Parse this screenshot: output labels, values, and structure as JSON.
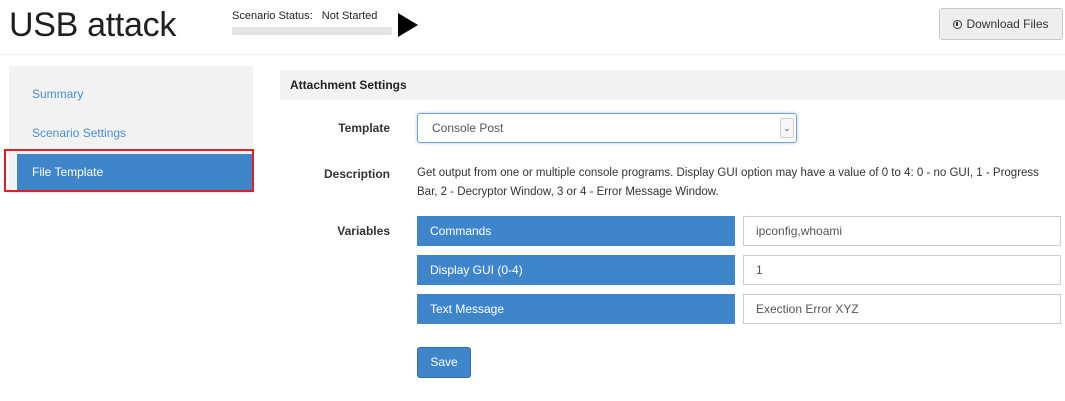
{
  "page": {
    "title": "USB attack"
  },
  "status": {
    "label": "Scenario Status:",
    "value": "Not Started"
  },
  "header": {
    "download_label": "Download Files",
    "download_icon": "download-circle-icon"
  },
  "sidebar": {
    "items": [
      {
        "label": "Summary",
        "active": false
      },
      {
        "label": "Scenario Settings",
        "active": false
      },
      {
        "label": "File Template",
        "active": true
      }
    ]
  },
  "panel": {
    "title": "Attachment Settings"
  },
  "form": {
    "template_label": "Template",
    "template_value": "Console Post",
    "description_label": "Description",
    "description_text": "Get output from one or multiple console programs. Display GUI option may have a value of 0 to 4: 0 - no GUI, 1 - Progress Bar, 2 - Decryptor Window, 3 or 4 - Error Message Window.",
    "variables_label": "Variables",
    "variables": [
      {
        "name": "Commands",
        "value": "ipconfig,whoami"
      },
      {
        "name": "Display GUI (0-4)",
        "value": "1"
      },
      {
        "name": "Text Message",
        "value": "Exection Error XYZ"
      }
    ],
    "save_label": "Save"
  },
  "colors": {
    "accent": "#3f85c9",
    "link": "#4a8fcf",
    "highlight": "#e21f26"
  }
}
